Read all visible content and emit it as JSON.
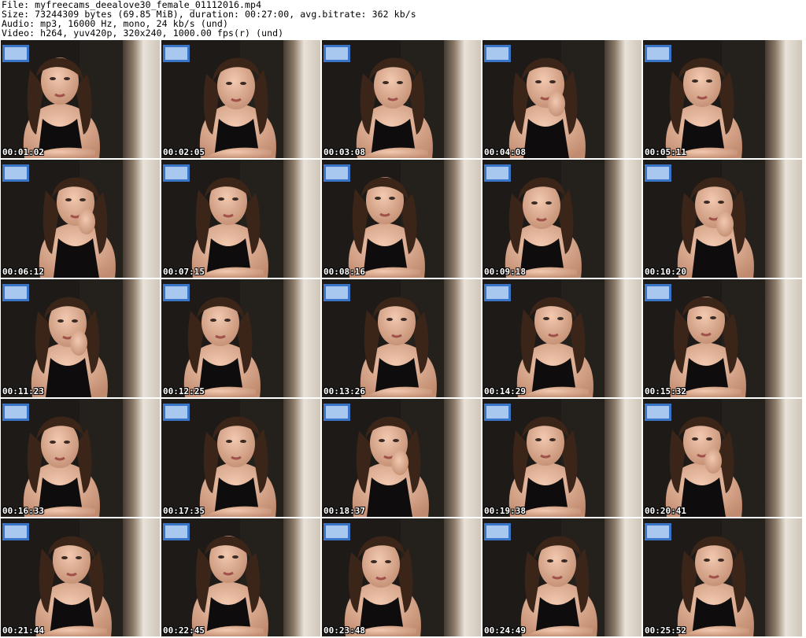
{
  "header": {
    "file": "File: myfreecams_deealove30_female_01112016.mp4",
    "size": "Size: 73244309 bytes (69.85 MiB), duration: 00:27:00, avg.bitrate: 362 kb/s",
    "audio": "Audio: mp3, 16000 Hz, mono, 24 kb/s (und)",
    "video": "Video: h264, yuv420p, 320x240, 1000.00 fps(r) (und)"
  },
  "thumbnails": [
    "00:01:02",
    "00:02:05",
    "00:03:08",
    "00:04:08",
    "00:05:11",
    "00:06:12",
    "00:07:15",
    "00:08:16",
    "00:09:18",
    "00:10:20",
    "00:11:23",
    "00:12:25",
    "00:13:26",
    "00:14:29",
    "00:15:32",
    "00:16:33",
    "00:17:35",
    "00:18:37",
    "00:19:38",
    "00:20:41",
    "00:21:44",
    "00:22:45",
    "00:23:48",
    "00:24:49",
    "00:25:52"
  ]
}
